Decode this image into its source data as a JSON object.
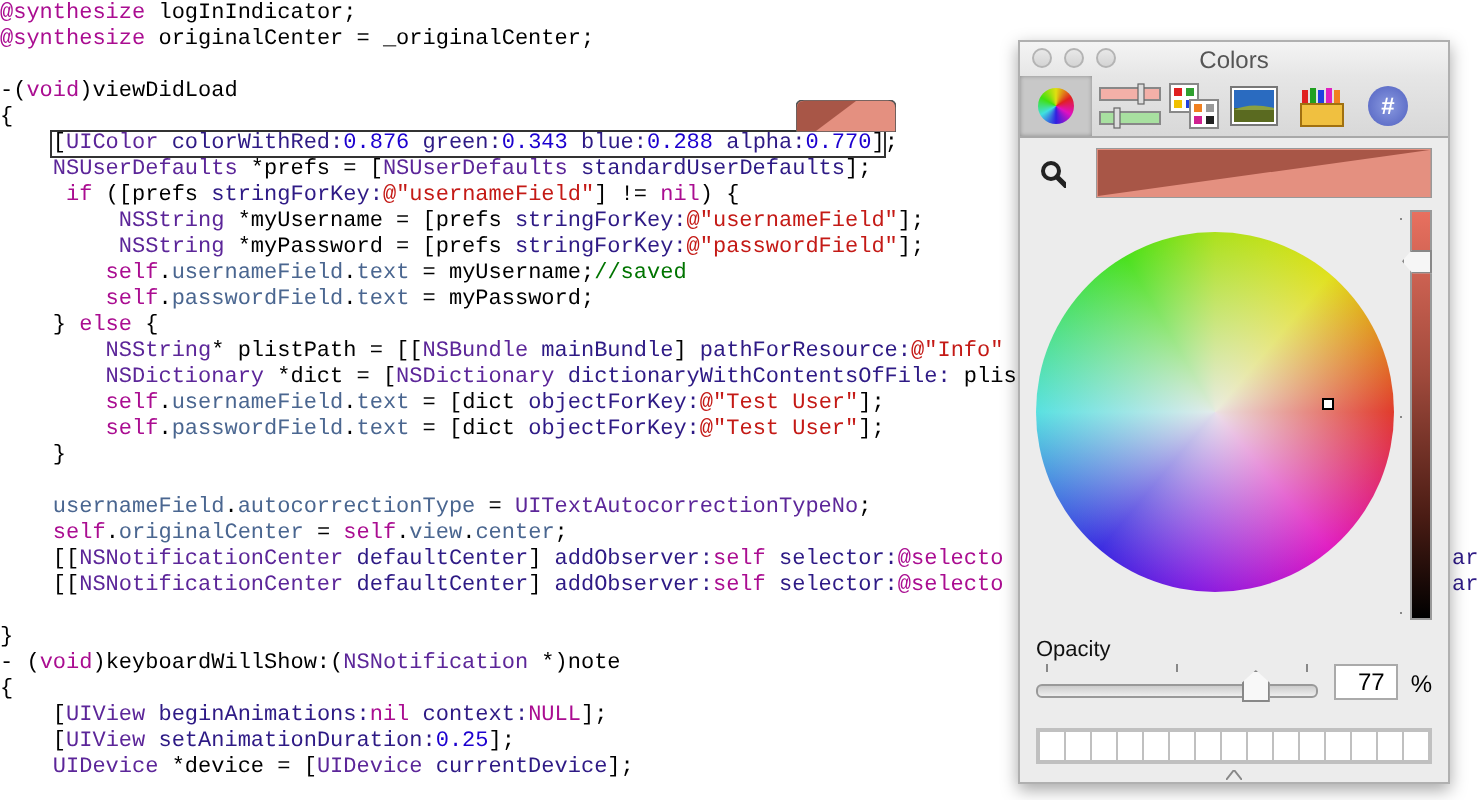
{
  "editor": {
    "lines": [
      {
        "kind": "code",
        "tokens": [
          {
            "t": "@synthesize",
            "kind": "keyword"
          },
          {
            "t": " logInIndicator;",
            "kind": "plain"
          }
        ]
      },
      {
        "kind": "code",
        "tokens": [
          {
            "t": "@synthesize",
            "kind": "keyword"
          },
          {
            "t": " originalCenter = _originalCenter;",
            "kind": "plain"
          }
        ]
      },
      {
        "kind": "blank"
      },
      {
        "kind": "code",
        "tokens": [
          {
            "t": "-(",
            "kind": "plain"
          },
          {
            "t": "void",
            "kind": "keyword"
          },
          {
            "t": ")viewDidLoad",
            "kind": "plain"
          }
        ]
      },
      {
        "kind": "code",
        "tokens": [
          {
            "t": "{",
            "kind": "plain"
          }
        ]
      },
      {
        "kind": "boxed",
        "box": [
          {
            "t": "[",
            "kind": "plain"
          },
          {
            "t": "UIColor",
            "kind": "class"
          },
          {
            "t": " colorWithRed:",
            "kind": "method"
          },
          {
            "t": "0.876",
            "kind": "number"
          },
          {
            "t": " green:",
            "kind": "method"
          },
          {
            "t": "0.343",
            "kind": "number"
          },
          {
            "t": " blue:",
            "kind": "method"
          },
          {
            "t": "0.288",
            "kind": "number"
          },
          {
            "t": " alpha:",
            "kind": "method"
          },
          {
            "t": "0.770",
            "kind": "number"
          },
          {
            "t": "]",
            "kind": "plain"
          }
        ],
        "tokens": [
          {
            "t": ";",
            "kind": "plain"
          }
        ]
      },
      {
        "kind": "code",
        "tokens": [
          {
            "t": "    NSUserDefaults",
            "kind": "class"
          },
          {
            "t": " *prefs = [",
            "kind": "plain"
          },
          {
            "t": "NSUserDefaults",
            "kind": "class"
          },
          {
            "t": " standardUserDefaults",
            "kind": "method"
          },
          {
            "t": "];",
            "kind": "plain"
          }
        ]
      },
      {
        "kind": "code",
        "tokens": [
          {
            "t": "     if",
            "kind": "keyword"
          },
          {
            "t": " ([prefs ",
            "kind": "plain"
          },
          {
            "t": "stringForKey:",
            "kind": "method"
          },
          {
            "t": "@\"usernameField\"",
            "kind": "string"
          },
          {
            "t": "] != ",
            "kind": "plain"
          },
          {
            "t": "nil",
            "kind": "keyword"
          },
          {
            "t": ") {",
            "kind": "plain"
          }
        ]
      },
      {
        "kind": "code",
        "tokens": [
          {
            "t": "         NSString",
            "kind": "class"
          },
          {
            "t": " *myUsername = [prefs ",
            "kind": "plain"
          },
          {
            "t": "stringForKey:",
            "kind": "method"
          },
          {
            "t": "@\"usernameField\"",
            "kind": "string"
          },
          {
            "t": "];",
            "kind": "plain"
          }
        ]
      },
      {
        "kind": "code",
        "tokens": [
          {
            "t": "         NSString",
            "kind": "class"
          },
          {
            "t": " *myPassword = [prefs ",
            "kind": "plain"
          },
          {
            "t": "stringForKey:",
            "kind": "method"
          },
          {
            "t": "@\"passwordField\"",
            "kind": "string"
          },
          {
            "t": "];",
            "kind": "plain"
          }
        ]
      },
      {
        "kind": "code",
        "tokens": [
          {
            "t": "        self",
            "kind": "keyword"
          },
          {
            "t": ".",
            "kind": "plain"
          },
          {
            "t": "usernameField",
            "kind": "project"
          },
          {
            "t": ".",
            "kind": "plain"
          },
          {
            "t": "text",
            "kind": "project"
          },
          {
            "t": " = myUsername;",
            "kind": "plain"
          },
          {
            "t": "//saved",
            "kind": "comment"
          }
        ]
      },
      {
        "kind": "code",
        "tokens": [
          {
            "t": "        self",
            "kind": "keyword"
          },
          {
            "t": ".",
            "kind": "plain"
          },
          {
            "t": "passwordField",
            "kind": "project"
          },
          {
            "t": ".",
            "kind": "plain"
          },
          {
            "t": "text",
            "kind": "project"
          },
          {
            "t": " = myPassword;",
            "kind": "plain"
          }
        ]
      },
      {
        "kind": "code",
        "tokens": [
          {
            "t": "    } ",
            "kind": "plain"
          },
          {
            "t": "else",
            "kind": "keyword"
          },
          {
            "t": " {",
            "kind": "plain"
          }
        ]
      },
      {
        "kind": "code",
        "tokens": [
          {
            "t": "        NSString",
            "kind": "class"
          },
          {
            "t": "* plistPath = [[",
            "kind": "plain"
          },
          {
            "t": "NSBundle",
            "kind": "class"
          },
          {
            "t": " mainBundle",
            "kind": "method"
          },
          {
            "t": "] ",
            "kind": "plain"
          },
          {
            "t": "pathForResource:",
            "kind": "method"
          },
          {
            "t": "@\"Info\"",
            "kind": "string"
          }
        ]
      },
      {
        "kind": "code",
        "tokens": [
          {
            "t": "        NSDictionary",
            "kind": "class"
          },
          {
            "t": " *dict = [",
            "kind": "plain"
          },
          {
            "t": "NSDictionary",
            "kind": "class"
          },
          {
            "t": " dictionaryWithContentsOfFile:",
            "kind": "method"
          },
          {
            "t": " plis",
            "kind": "plain"
          }
        ]
      },
      {
        "kind": "code",
        "tokens": [
          {
            "t": "        self",
            "kind": "keyword"
          },
          {
            "t": ".",
            "kind": "plain"
          },
          {
            "t": "usernameField",
            "kind": "project"
          },
          {
            "t": ".",
            "kind": "plain"
          },
          {
            "t": "text",
            "kind": "project"
          },
          {
            "t": " = [dict ",
            "kind": "plain"
          },
          {
            "t": "objectForKey:",
            "kind": "method"
          },
          {
            "t": "@\"Test User\"",
            "kind": "string"
          },
          {
            "t": "];",
            "kind": "plain"
          }
        ]
      },
      {
        "kind": "code",
        "tokens": [
          {
            "t": "        self",
            "kind": "keyword"
          },
          {
            "t": ".",
            "kind": "plain"
          },
          {
            "t": "passwordField",
            "kind": "project"
          },
          {
            "t": ".",
            "kind": "plain"
          },
          {
            "t": "text",
            "kind": "project"
          },
          {
            "t": " = [dict ",
            "kind": "plain"
          },
          {
            "t": "objectForKey:",
            "kind": "method"
          },
          {
            "t": "@\"Test User\"",
            "kind": "string"
          },
          {
            "t": "];",
            "kind": "plain"
          }
        ]
      },
      {
        "kind": "code",
        "tokens": [
          {
            "t": "    }",
            "kind": "plain"
          }
        ]
      },
      {
        "kind": "blank"
      },
      {
        "kind": "code",
        "tokens": [
          {
            "t": "    usernameField",
            "kind": "project"
          },
          {
            "t": ".",
            "kind": "plain"
          },
          {
            "t": "autocorrectionType",
            "kind": "project"
          },
          {
            "t": " = ",
            "kind": "plain"
          },
          {
            "t": "UITextAutocorrectionTypeNo",
            "kind": "class"
          },
          {
            "t": ";",
            "kind": "plain"
          }
        ]
      },
      {
        "kind": "code",
        "tokens": [
          {
            "t": "    self",
            "kind": "keyword"
          },
          {
            "t": ".",
            "kind": "plain"
          },
          {
            "t": "originalCenter",
            "kind": "project"
          },
          {
            "t": " = ",
            "kind": "plain"
          },
          {
            "t": "self",
            "kind": "keyword"
          },
          {
            "t": ".",
            "kind": "plain"
          },
          {
            "t": "view",
            "kind": "project"
          },
          {
            "t": ".",
            "kind": "plain"
          },
          {
            "t": "center",
            "kind": "project"
          },
          {
            "t": ";",
            "kind": "plain"
          }
        ]
      },
      {
        "kind": "code",
        "tokens": [
          {
            "t": "    [[",
            "kind": "plain"
          },
          {
            "t": "NSNotificationCenter",
            "kind": "class"
          },
          {
            "t": " defaultCenter",
            "kind": "method"
          },
          {
            "t": "] ",
            "kind": "plain"
          },
          {
            "t": "addObserver:",
            "kind": "method"
          },
          {
            "t": "self",
            "kind": "keyword"
          },
          {
            "t": " selector:",
            "kind": "method"
          },
          {
            "t": "@selecto",
            "kind": "keyword"
          }
        ],
        "tail": "ar"
      },
      {
        "kind": "code",
        "tokens": [
          {
            "t": "    [[",
            "kind": "plain"
          },
          {
            "t": "NSNotificationCenter",
            "kind": "class"
          },
          {
            "t": " defaultCenter",
            "kind": "method"
          },
          {
            "t": "] ",
            "kind": "plain"
          },
          {
            "t": "addObserver:",
            "kind": "method"
          },
          {
            "t": "self",
            "kind": "keyword"
          },
          {
            "t": " selector:",
            "kind": "method"
          },
          {
            "t": "@selecto",
            "kind": "keyword"
          }
        ],
        "tail": "ar"
      },
      {
        "kind": "blank"
      },
      {
        "kind": "code",
        "tokens": [
          {
            "t": "}",
            "kind": "plain"
          }
        ]
      },
      {
        "kind": "code",
        "tokens": [
          {
            "t": "- (",
            "kind": "plain"
          },
          {
            "t": "void",
            "kind": "keyword"
          },
          {
            "t": ")keyboardWillShow:(",
            "kind": "plain"
          },
          {
            "t": "NSNotification",
            "kind": "class"
          },
          {
            "t": " *)note",
            "kind": "plain"
          }
        ]
      },
      {
        "kind": "code",
        "tokens": [
          {
            "t": "{",
            "kind": "plain"
          }
        ]
      },
      {
        "kind": "code",
        "tokens": [
          {
            "t": "    [",
            "kind": "plain"
          },
          {
            "t": "UIView",
            "kind": "class"
          },
          {
            "t": " beginAnimations:",
            "kind": "method"
          },
          {
            "t": "nil",
            "kind": "keyword"
          },
          {
            "t": " context:",
            "kind": "method"
          },
          {
            "t": "NULL",
            "kind": "keyword"
          },
          {
            "t": "];",
            "kind": "plain"
          }
        ]
      },
      {
        "kind": "code",
        "tokens": [
          {
            "t": "    [",
            "kind": "plain"
          },
          {
            "t": "UIView",
            "kind": "class"
          },
          {
            "t": " setAnimationDuration:",
            "kind": "method"
          },
          {
            "t": "0.25",
            "kind": "number"
          },
          {
            "t": "];",
            "kind": "plain"
          }
        ]
      },
      {
        "kind": "code",
        "tokens": [
          {
            "t": "    UIDevice",
            "kind": "class"
          },
          {
            "t": " *device = [",
            "kind": "plain"
          },
          {
            "t": "UIDevice",
            "kind": "class"
          },
          {
            "t": " currentDevice",
            "kind": "method"
          },
          {
            "t": "];",
            "kind": "plain"
          }
        ]
      }
    ]
  },
  "colors_panel": {
    "title": "Colors",
    "tools": [
      {
        "kind": "wheel",
        "selected": true
      },
      {
        "kind": "sliders",
        "selected": false
      },
      {
        "kind": "palettes",
        "selected": false
      },
      {
        "kind": "image",
        "selected": false
      },
      {
        "kind": "crayons",
        "selected": false
      },
      {
        "kind": "hex",
        "selected": false,
        "glyph": "#"
      }
    ],
    "brightness": {
      "level": 0.88
    },
    "opacity": {
      "label": "Opacity",
      "level": 0.77,
      "value": "77",
      "unit": "%"
    }
  }
}
